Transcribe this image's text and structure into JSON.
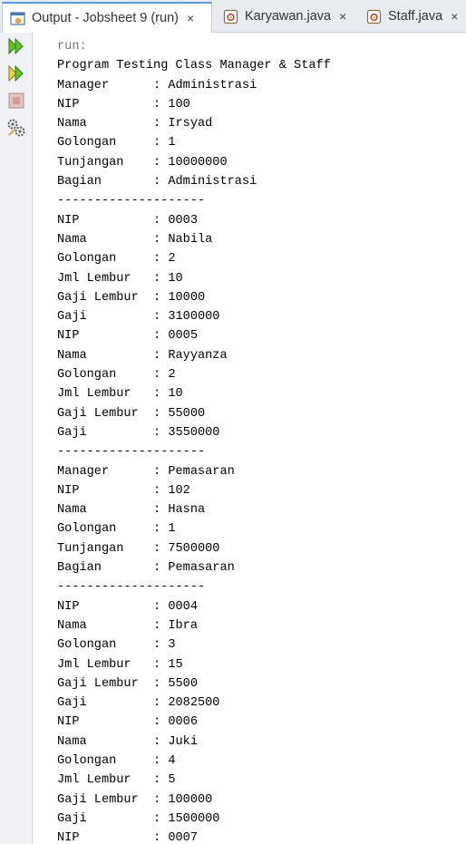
{
  "tabs": [
    {
      "label": "Output - Jobsheet 9 (run)",
      "close": "×",
      "icon": "output-icon",
      "active": true
    },
    {
      "label": "Karyawan.java",
      "close": "×",
      "icon": "java-file-icon",
      "active": false
    },
    {
      "label": "Staff.java",
      "close": "×",
      "icon": "java-file-icon",
      "active": false
    }
  ],
  "sidebar": {
    "buttons": [
      "rerun-icon",
      "rerun-with-options-icon",
      "stop-icon",
      "settings-icon"
    ]
  },
  "console": {
    "lines": [
      "run:",
      "Program Testing Class Manager & Staff",
      "Manager      : Administrasi",
      "NIP          : 100",
      "Nama         : Irsyad",
      "Golongan     : 1",
      "Tunjangan    : 10000000",
      "Bagian       : Administrasi",
      "--------------------",
      "NIP          : 0003",
      "Nama         : Nabila",
      "Golongan     : 2",
      "Jml Lembur   : 10",
      "Gaji Lembur  : 10000",
      "Gaji         : 3100000",
      "NIP          : 0005",
      "Nama         : Rayyanza",
      "Golongan     : 2",
      "Jml Lembur   : 10",
      "Gaji Lembur  : 55000",
      "Gaji         : 3550000",
      "--------------------",
      "Manager      : Pemasaran",
      "NIP          : 102",
      "Nama         : Hasna",
      "Golongan     : 1",
      "Tunjangan    : 7500000",
      "Bagian       : Pemasaran",
      "--------------------",
      "NIP          : 0004",
      "Nama         : Ibra",
      "Golongan     : 3",
      "Jml Lembur   : 15",
      "Gaji Lembur  : 5500",
      "Gaji         : 2082500",
      "NIP          : 0006",
      "Nama         : Juki",
      "Golongan     : 4",
      "Jml Lembur   : 5",
      "Gaji Lembur  : 100000",
      "Gaji         : 1500000",
      "NIP          : 0007"
    ]
  },
  "colors": {
    "accent": "#5a9be0",
    "run_green": "#4caf1c",
    "stop_red": "#c0392b"
  }
}
